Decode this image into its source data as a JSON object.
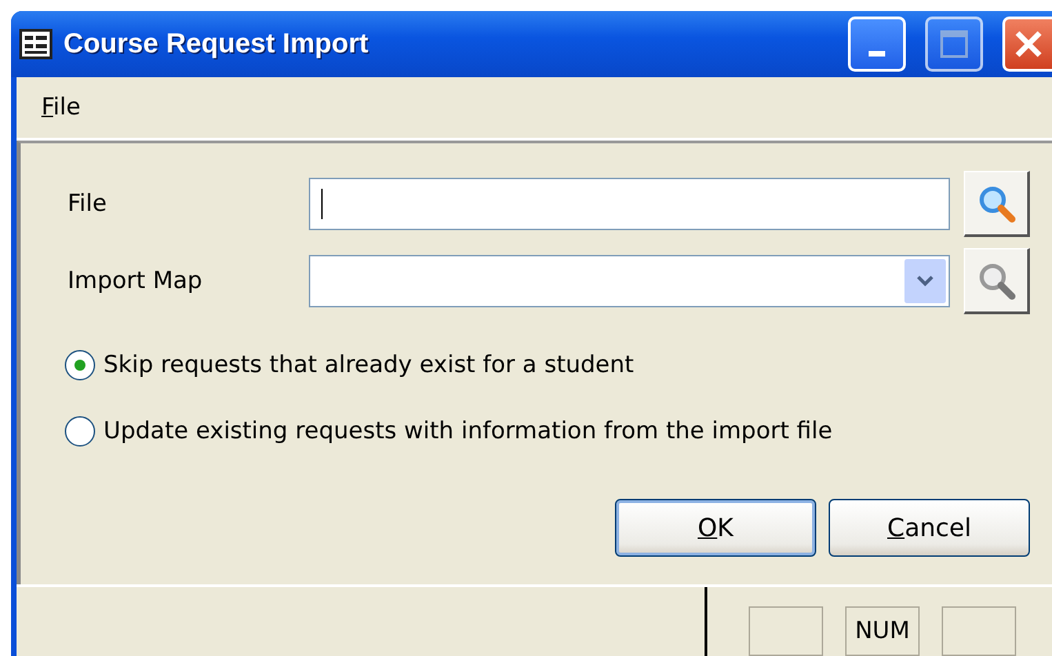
{
  "window": {
    "title": "Course Request Import"
  },
  "menu": [
    {
      "label": "File",
      "underline_first": true
    }
  ],
  "fields": [
    {
      "label": "File",
      "kind": "text",
      "focused": true
    },
    {
      "label": "Import Map",
      "kind": "dropdown",
      "focused": false
    }
  ],
  "options": [
    {
      "label": "Skip requests that already exist for a student",
      "selected": true
    },
    {
      "label": "Update existing requests with information from the import file",
      "selected": false
    }
  ],
  "buttons": [
    {
      "label": "OK",
      "underline_first": true,
      "default": true
    },
    {
      "label": "Cancel",
      "underline_first": true,
      "default": false
    }
  ],
  "status_bar": {
    "indicator": "NUM"
  }
}
